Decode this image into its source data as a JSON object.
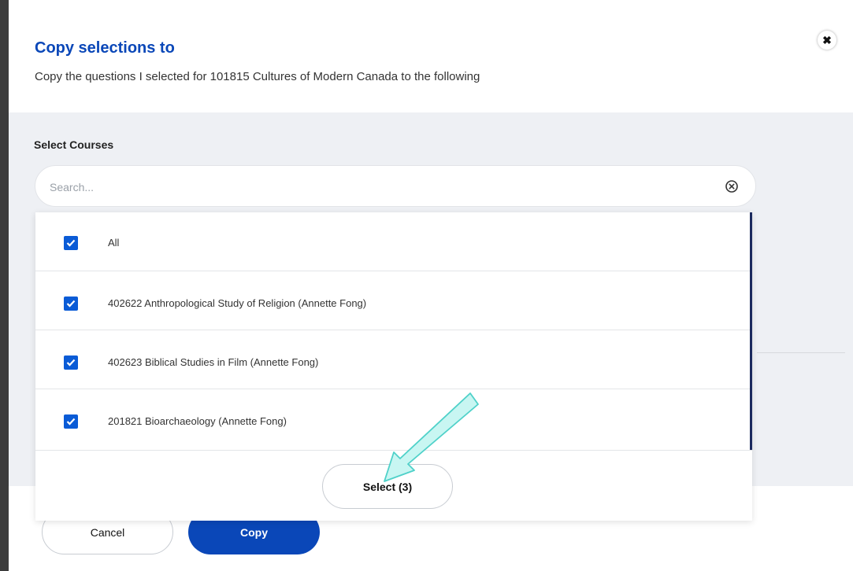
{
  "dialog": {
    "title": "Copy selections to",
    "subtitle": "Copy the questions I selected for 101815 Cultures of Modern Canada to the following",
    "close_icon": "close-icon"
  },
  "courses": {
    "label": "Select Courses",
    "search_placeholder": "Search...",
    "search_value": "",
    "clear_icon": "clear-circle-icon",
    "options": [
      {
        "label": "All",
        "checked": true
      },
      {
        "label": "402622 Anthropological Study of Religion (Annette Fong)",
        "checked": true
      },
      {
        "label": "402623 Biblical Studies in Film (Annette Fong)",
        "checked": true
      },
      {
        "label": "201821 Bioarchaeology (Annette Fong)",
        "checked": true
      }
    ],
    "select_button": "Select  (3)"
  },
  "footer": {
    "cancel_label": "Cancel",
    "copy_label": "Copy"
  },
  "colors": {
    "accent": "#0a47b8",
    "checkbox": "#0a5bd6",
    "arrow_annotation": "#7fe6e0"
  }
}
